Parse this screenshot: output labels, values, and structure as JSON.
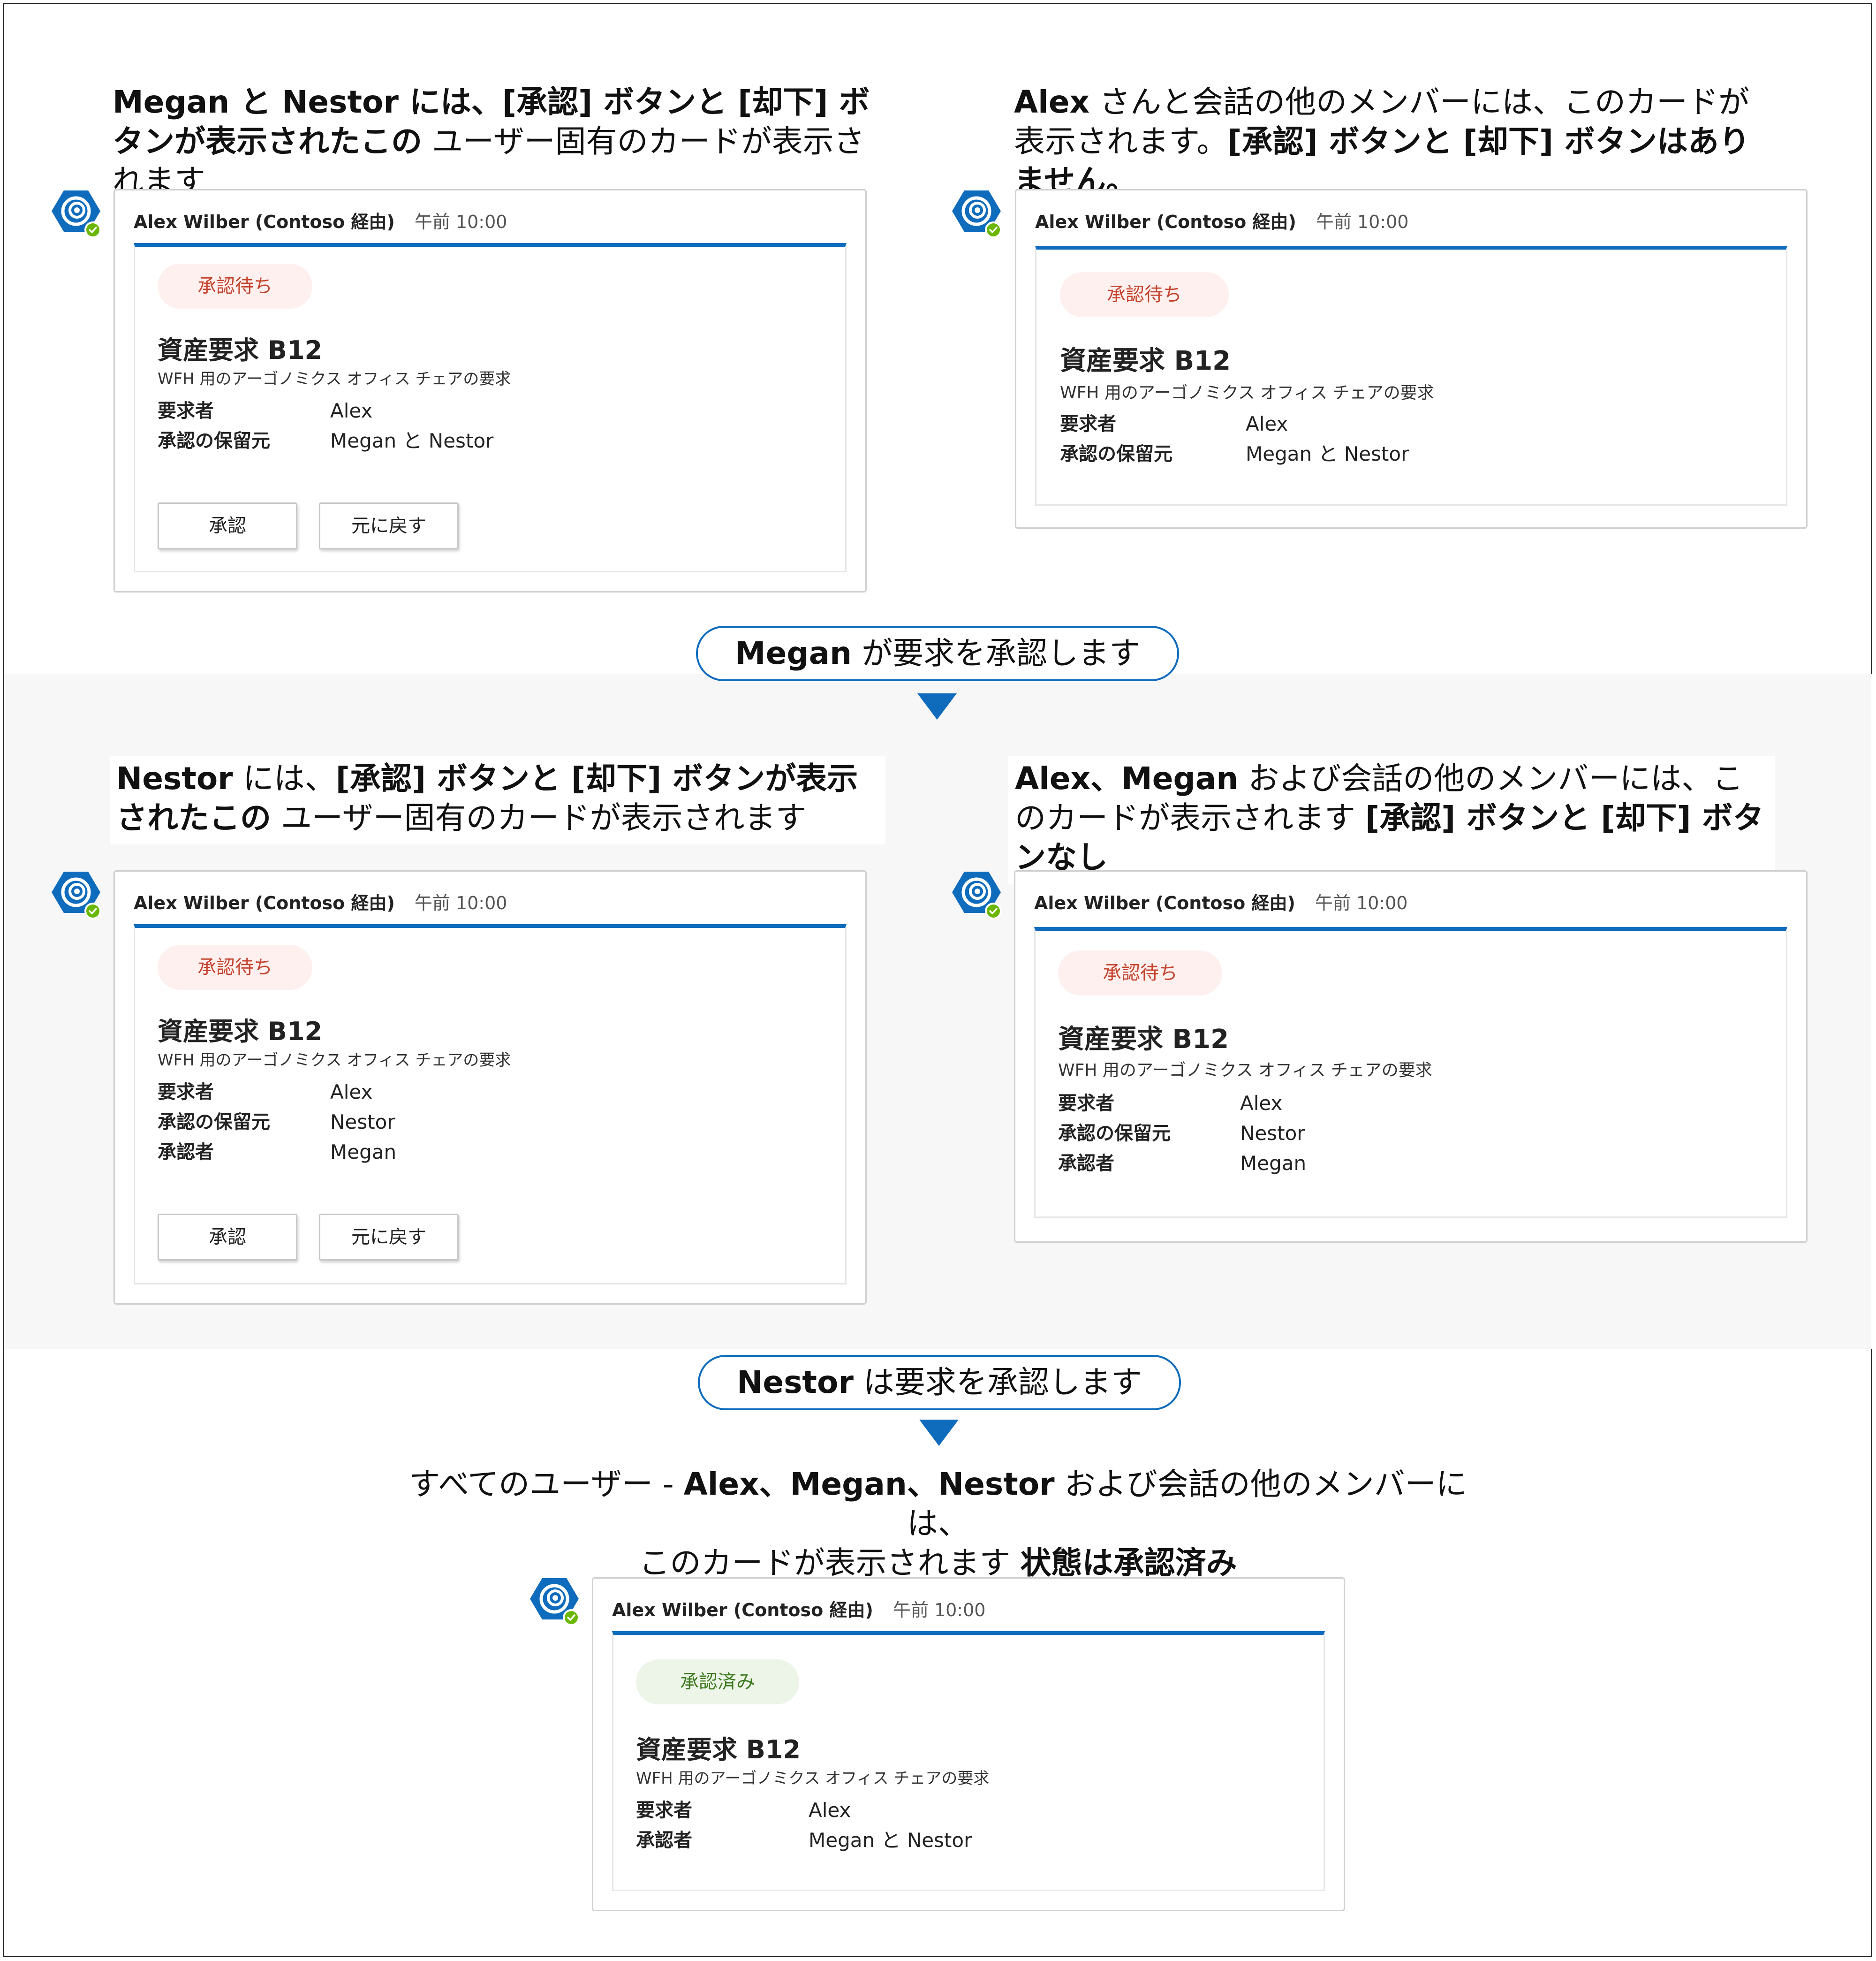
{
  "colors": {
    "accent": "#0f6cbd",
    "pending_bg": "#fdf0ee",
    "pending_text": "#c5442f",
    "approved_bg": "#edf5e8",
    "approved_text": "#3d7a1f",
    "band_bg": "#f7f7f7"
  },
  "icons": {
    "bot": "bot-avatar-icon",
    "presence": "presence-available-icon",
    "arrow": "arrow-down-icon"
  },
  "captions": {
    "top_left": {
      "a": "Megan と Nestor には、[承認] ボタンと [却下] ボタンが表示されたこの",
      "b": " ユーザー固有のカードが表示されます"
    },
    "top_right": {
      "a": "Alex",
      "b": " さんと会話の他のメンバーには、このカードが表示されます。",
      "c": "[承認] ボタンと [却下] ボタンはありません。"
    },
    "mid_left": {
      "a": "Nestor",
      "b": " には、",
      "c": "[承認] ボタンと [却下] ボタンが表示されたこの",
      "d": " ユーザー固有のカードが表示されます"
    },
    "mid_right": {
      "a": "Alex、Megan",
      "b": " および会話の他のメンバーには、このカードが表示されます ",
      "c": "[承認] ボタンと [却下] ボタンなし"
    },
    "bottom": {
      "a": "すべてのユーザー - ",
      "b": "Alex、Megan、Nestor",
      "c": " および会話の他のメンバーには、",
      "d": "このカードが表示されます ",
      "e": "状態は承認済み"
    }
  },
  "steps": [
    {
      "name": "Megan",
      "text": " が要求を承認します"
    },
    {
      "name": "Nestor",
      "text": " は要求を承認します"
    }
  ],
  "card_common": {
    "sender": "Alex Wilber (Contoso 経由)",
    "time": "午前 10:00",
    "title": "資産要求 B12",
    "subtitle": "WFH 用のアーゴノミクス オフィス チェアの要求"
  },
  "cards": [
    {
      "status": "承認待ち",
      "fields": [
        {
          "key": "要求者",
          "value": "Alex"
        },
        {
          "key": "承認の保留元",
          "value": "Megan と Nestor"
        }
      ],
      "buttons": [
        "承認",
        "元に戻す"
      ]
    },
    {
      "status": "承認待ち",
      "fields": [
        {
          "key": "要求者",
          "value": "Alex"
        },
        {
          "key": "承認の保留元",
          "value": "Megan と Nestor"
        }
      ]
    },
    {
      "status": "承認待ち",
      "fields": [
        {
          "key": "要求者",
          "value": "Alex"
        },
        {
          "key": "承認の保留元",
          "value": "Nestor"
        },
        {
          "key": "承認者",
          "value": "Megan"
        }
      ],
      "buttons": [
        "承認",
        "元に戻す"
      ]
    },
    {
      "status": "承認待ち",
      "fields": [
        {
          "key": "要求者",
          "value": "Alex"
        },
        {
          "key": "承認の保留元",
          "value": "Nestor"
        },
        {
          "key": "承認者",
          "value": "Megan"
        }
      ]
    },
    {
      "status": "承認済み",
      "fields": [
        {
          "key": "要求者",
          "value": "Alex"
        },
        {
          "key": "承認者",
          "value": "Megan と Nestor"
        }
      ]
    }
  ]
}
